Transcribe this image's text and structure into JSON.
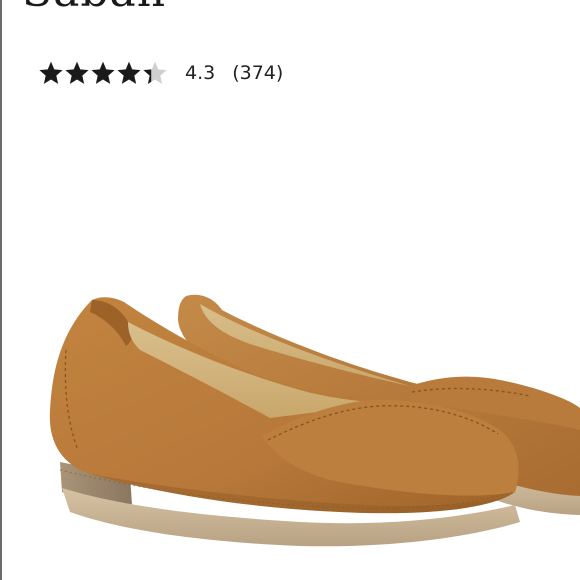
{
  "product": {
    "title": "Saban",
    "rating": {
      "value_label": "4.3",
      "value": 4.3,
      "max": 5,
      "count_label": "(374)"
    },
    "image": {
      "icon": "tan-suede-loafers-photo"
    }
  },
  "colors": {
    "star_fill": "#1a1a1a",
    "star_empty": "#cfcfcf",
    "suede": "#b77a3c",
    "sole": "#c8b497"
  }
}
